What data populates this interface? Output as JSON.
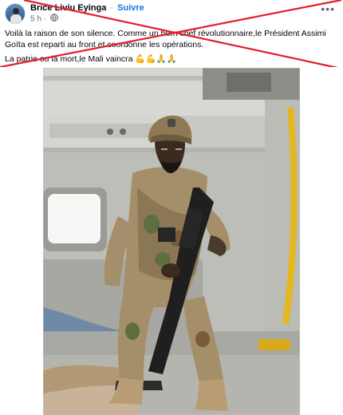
{
  "post": {
    "author_name": "Brice Liviu Eyinga",
    "separator": "·",
    "follow_label": "Suivre",
    "timestamp": "5 h ·",
    "more_label": "•••",
    "caption_line1": "Voilà la raison de son silence. Comme un born chef révolutionnaire,le Président Assimi Goïta est reparti au front et coordonne les opérations.",
    "caption_line2": "La patrie ou la mort,le Mali vaincra 💪💪🙏🙏"
  },
  "icons": {
    "avatar": "profile-avatar",
    "audience": "globe-icon",
    "menu": "more-options-icon"
  },
  "colors": {
    "strike": "#e0202a",
    "link": "#1b74e4",
    "muted": "#65676b"
  }
}
